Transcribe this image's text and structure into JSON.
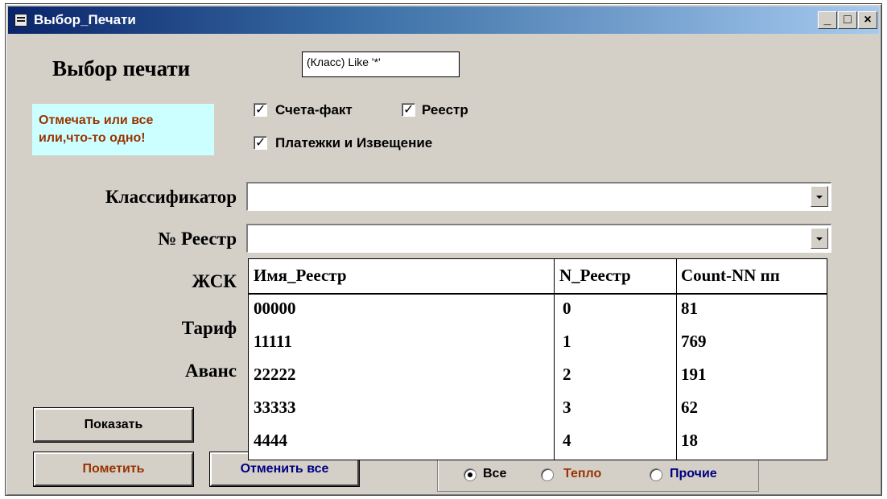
{
  "window": {
    "title": "Выбор_Печати",
    "buttons": {
      "minimize": "_",
      "maximize": "□",
      "close": "×"
    }
  },
  "form": {
    "heading": "Выбор печати",
    "filter_text": "(Класс) Like '*'",
    "hint": {
      "line1": "Отмечать или все",
      "line2": "или,что-то одно!"
    },
    "checkboxes": [
      {
        "label": "Счета-факт",
        "checked": true
      },
      {
        "label": "Реестр",
        "checked": true
      },
      {
        "label": "Платежки и Извещение",
        "checked": true
      }
    ],
    "labels": {
      "classifier": "Классификатор",
      "registry": "№ Реестр",
      "zhsk": "ЖСК",
      "tariff": "Тариф",
      "advance": "Аванс"
    },
    "classifier_value": "",
    "registry_value": "",
    "buttons": {
      "show": "Показать",
      "mark": "Пометить",
      "cancel_all": "Отменить все"
    },
    "radio_options": [
      {
        "label": "Все",
        "selected": true,
        "color": "#000000"
      },
      {
        "label": "Тепло",
        "selected": false,
        "color": "#993300"
      },
      {
        "label": "Прочие",
        "selected": false,
        "color": "#000080"
      }
    ]
  },
  "dropdown": {
    "columns": [
      "Имя_Реестр",
      "N_Реестр",
      "Count-NN пп"
    ],
    "rows": [
      [
        "00000",
        "0",
        "81"
      ],
      [
        "11111",
        "1",
        "769"
      ],
      [
        "22222",
        "2",
        "191"
      ],
      [
        "33333",
        "3",
        "62"
      ],
      [
        "4444",
        "4",
        "18"
      ]
    ]
  },
  "colors": {
    "title_bar_start": "#0a246a",
    "form_bg": "#d4d0c8",
    "hint_bg": "#ccffff",
    "hint_text": "#993300",
    "mark_button_text": "#993300",
    "cancel_button_text": "#000080"
  }
}
